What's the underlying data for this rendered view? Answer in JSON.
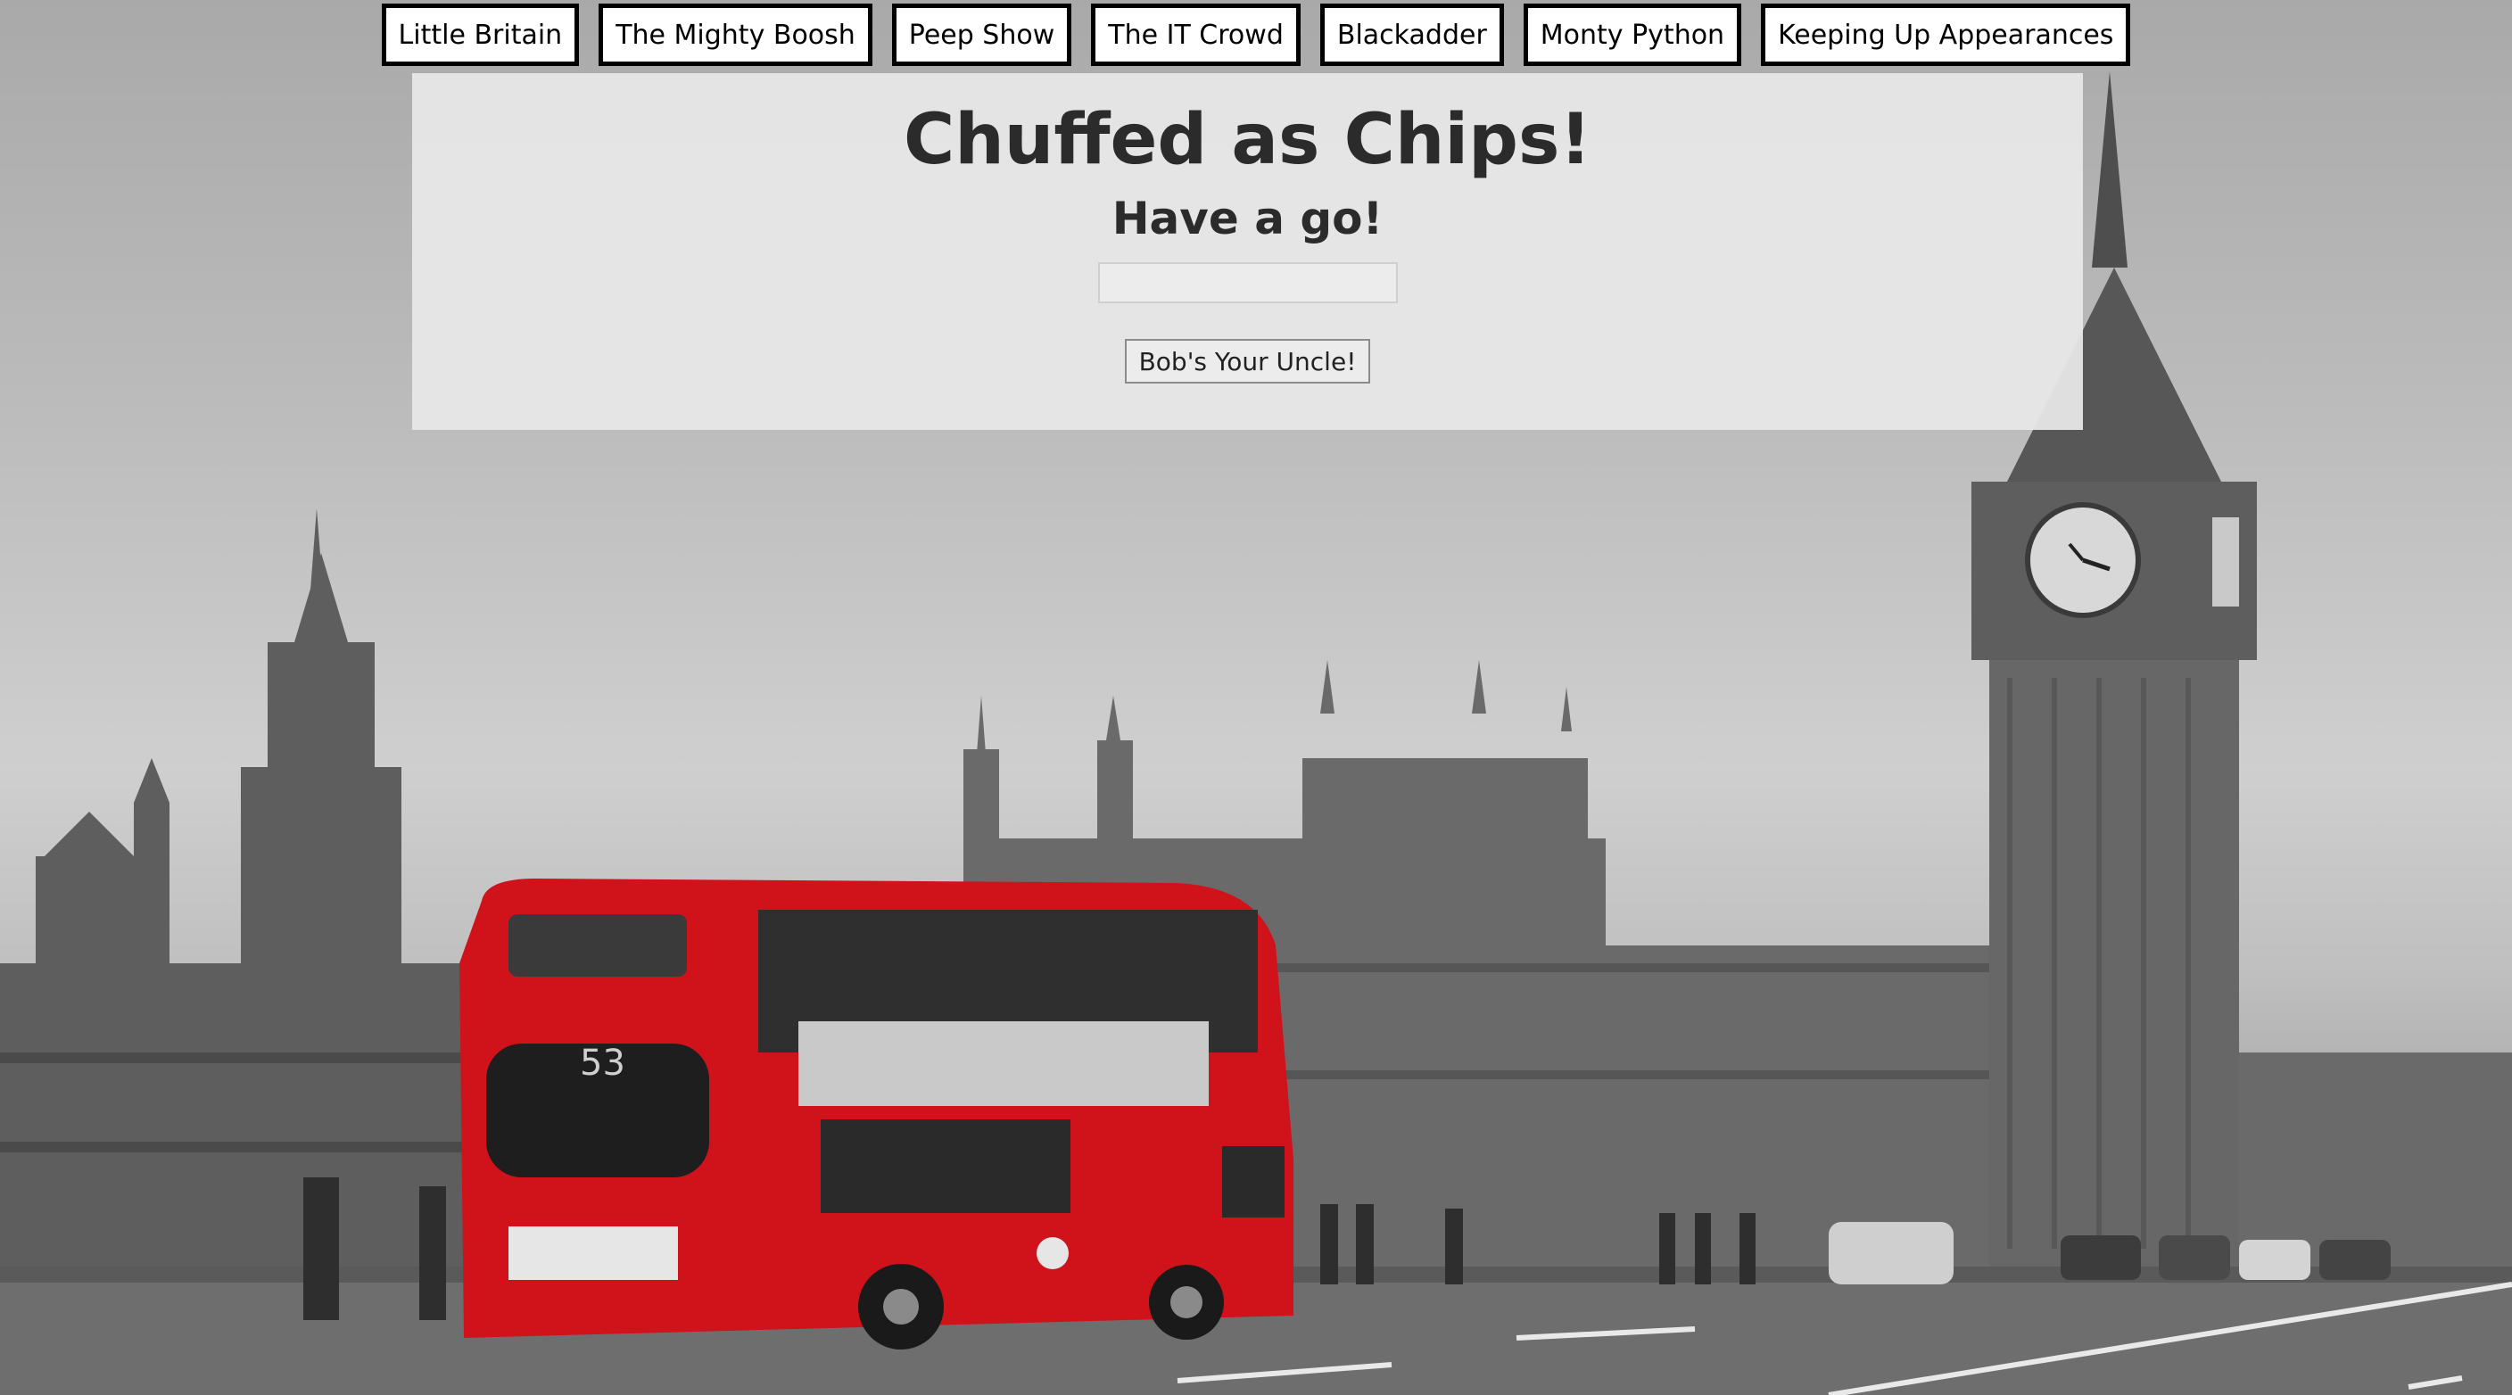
{
  "nav": {
    "items": [
      {
        "label": "Little Britain"
      },
      {
        "label": "The Mighty Boosh"
      },
      {
        "label": "Peep Show"
      },
      {
        "label": "The IT Crowd"
      },
      {
        "label": "Blackadder"
      },
      {
        "label": "Monty Python"
      },
      {
        "label": "Keeping Up Appearances"
      }
    ]
  },
  "main": {
    "title": "Chuffed as Chips!",
    "subtitle": "Have a go!",
    "input_value": "",
    "button_label": "Bob's Your Uncle!"
  },
  "background": {
    "bus_route_number": "53",
    "bus_color": "#d0121b"
  }
}
